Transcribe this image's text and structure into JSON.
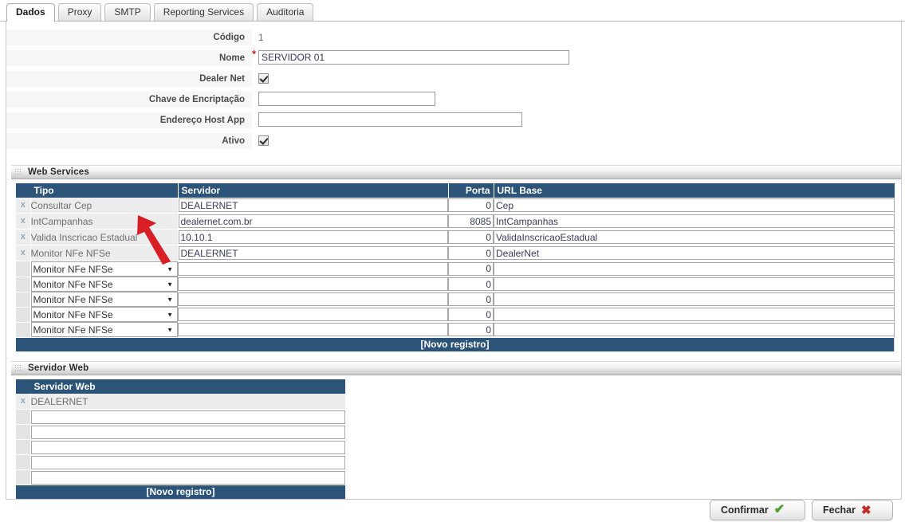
{
  "tabs": [
    {
      "label": "Dados",
      "active": true
    },
    {
      "label": "Proxy",
      "active": false
    },
    {
      "label": "SMTP",
      "active": false
    },
    {
      "label": "Reporting Services",
      "active": false
    },
    {
      "label": "Auditoria",
      "active": false
    }
  ],
  "form": {
    "codigo_label": "Código",
    "codigo_value": "1",
    "nome_label": "Nome",
    "nome_value": "SERVIDOR 01",
    "nome_required_mark": "*",
    "dealernet_label": "Dealer Net",
    "dealernet_checked": true,
    "chave_label": "Chave de Encriptação",
    "chave_value": "",
    "host_label": "Endereço Host App",
    "host_value": "",
    "ativo_label": "Ativo",
    "ativo_checked": true
  },
  "web_services": {
    "section_title": "Web Services",
    "columns": [
      "Tipo",
      "Servidor",
      "Porta",
      "URL Base"
    ],
    "delete_icon": "x",
    "rows": [
      {
        "tipo": "Consultar Cep",
        "servidor": "DEALERNET",
        "porta": "0",
        "url": "Cep"
      },
      {
        "tipo": "IntCampanhas",
        "servidor": "dealernet.com.br",
        "porta": "8085",
        "url": "IntCampanhas"
      },
      {
        "tipo": "Valida Inscricao Estadual",
        "servidor": "10.10.1",
        "porta": "0",
        "url": "ValidaInscricaoEstadual"
      },
      {
        "tipo": "Monitor NFe NFSe",
        "servidor": "DEALERNET",
        "porta": "0",
        "url": "DealerNet"
      }
    ],
    "new_rows": [
      {
        "tipo": "Monitor NFe NFSe",
        "servidor": "",
        "porta": "0",
        "url": ""
      },
      {
        "tipo": "Monitor NFe NFSe",
        "servidor": "",
        "porta": "0",
        "url": ""
      },
      {
        "tipo": "Monitor NFe NFSe",
        "servidor": "",
        "porta": "0",
        "url": ""
      },
      {
        "tipo": "Monitor NFe NFSe",
        "servidor": "",
        "porta": "0",
        "url": ""
      },
      {
        "tipo": "Monitor NFe NFSe",
        "servidor": "",
        "porta": "0",
        "url": ""
      }
    ],
    "tipo_options": [
      "Monitor NFe NFSe",
      "Consultar Cep",
      "IntCampanhas",
      "Valida Inscricao Estadual"
    ],
    "footer_label": "[Novo registro]"
  },
  "servidor_web": {
    "section_title": "Servidor Web",
    "column": "Servidor Web",
    "delete_icon": "x",
    "rows": [
      {
        "nome": "DEALERNET"
      }
    ],
    "new_rows": [
      {
        "nome": ""
      },
      {
        "nome": ""
      },
      {
        "nome": ""
      },
      {
        "nome": ""
      },
      {
        "nome": ""
      }
    ],
    "footer_label": "[Novo registro]"
  },
  "footer": {
    "confirm_label": "Confirmar",
    "confirm_icon": "check-icon",
    "close_label": "Fechar",
    "close_icon": "x-icon"
  },
  "annotation": {
    "arrow_color": "#d81f26",
    "points_at": "Valida Inscricao Estadual"
  },
  "colors": {
    "grid_header": "#2c5478",
    "accent_green": "#4aa02c",
    "accent_red": "#c62828",
    "required_star": "#c02020"
  }
}
